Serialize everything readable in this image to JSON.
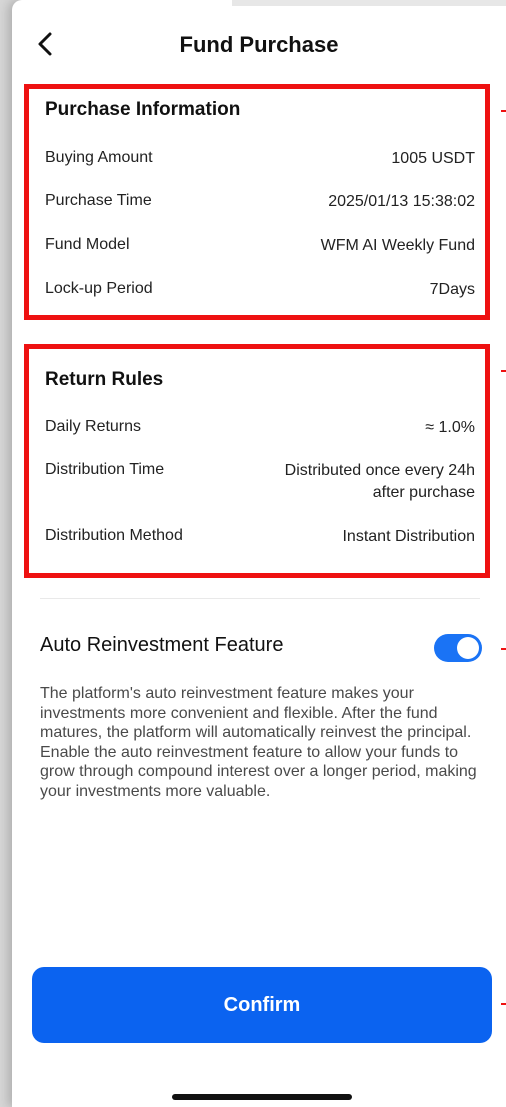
{
  "header": {
    "title": "Fund Purchase",
    "back_icon": "chevron-left-icon"
  },
  "purchase_info": {
    "title": "Purchase Information",
    "rows": [
      {
        "label": "Buying Amount",
        "value": "1005 USDT"
      },
      {
        "label": "Purchase Time",
        "value": "2025/01/13 15:38:02"
      },
      {
        "label": "Fund Model",
        "value": "WFM AI Weekly Fund"
      },
      {
        "label": "Lock-up Period",
        "value": "7Days"
      }
    ]
  },
  "return_rules": {
    "title": "Return Rules",
    "rows": [
      {
        "label": "Daily Returns",
        "value": "≈ 1.0%"
      },
      {
        "label": "Distribution Time",
        "value_line1": "Distributed once every 24h",
        "value_line2": "after purchase"
      },
      {
        "label": "Distribution Method",
        "value": "Instant Distribution"
      }
    ]
  },
  "auto_reinvest": {
    "title": "Auto Reinvestment Feature",
    "enabled": true,
    "description": "The platform's auto reinvestment feature makes your investments more convenient and flexible. After the fund matures, the platform will automatically reinvest the principal. Enable the auto reinvestment feature to allow your funds to grow through compound interest over a longer period, making your investments more valuable."
  },
  "actions": {
    "confirm_label": "Confirm"
  },
  "colors": {
    "accent": "#0b63f0",
    "toggle_on": "#1a73f5",
    "highlight_border": "#ee1111"
  }
}
